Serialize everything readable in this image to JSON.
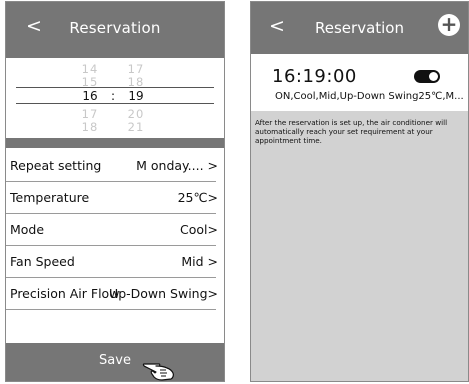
{
  "left_screen": {
    "back_label": "<",
    "title": "Reservation",
    "picker": {
      "hours_above": [
        "14",
        "15"
      ],
      "minutes_above": [
        "17",
        "18"
      ],
      "selected_hour": "16",
      "separator": ":",
      "selected_minute": "19",
      "hours_below": [
        "17",
        "18"
      ],
      "minutes_below": [
        "20",
        "21"
      ]
    },
    "settings": [
      {
        "label": "Repeat setting",
        "value": "M onday.... >"
      },
      {
        "label": "Temperature",
        "value": "25℃>"
      },
      {
        "label": "Mode",
        "value": "Cool>"
      },
      {
        "label": "Fan Speed",
        "value": "Mid >"
      },
      {
        "label": "Precision Air Flow",
        "value": "Up-Down Swing>"
      }
    ],
    "save_label": "Save"
  },
  "right_screen": {
    "back_label": "<",
    "title": "Reservation",
    "add_label": "+",
    "reservation": {
      "time": "16:19:00",
      "summary": "ON,Cool,Mid,Up-Down Swing25℃,M...",
      "enabled": true
    },
    "note": "After the reservation is set up, the air conditioner will automatically reach your set requirement at your appointment time."
  }
}
